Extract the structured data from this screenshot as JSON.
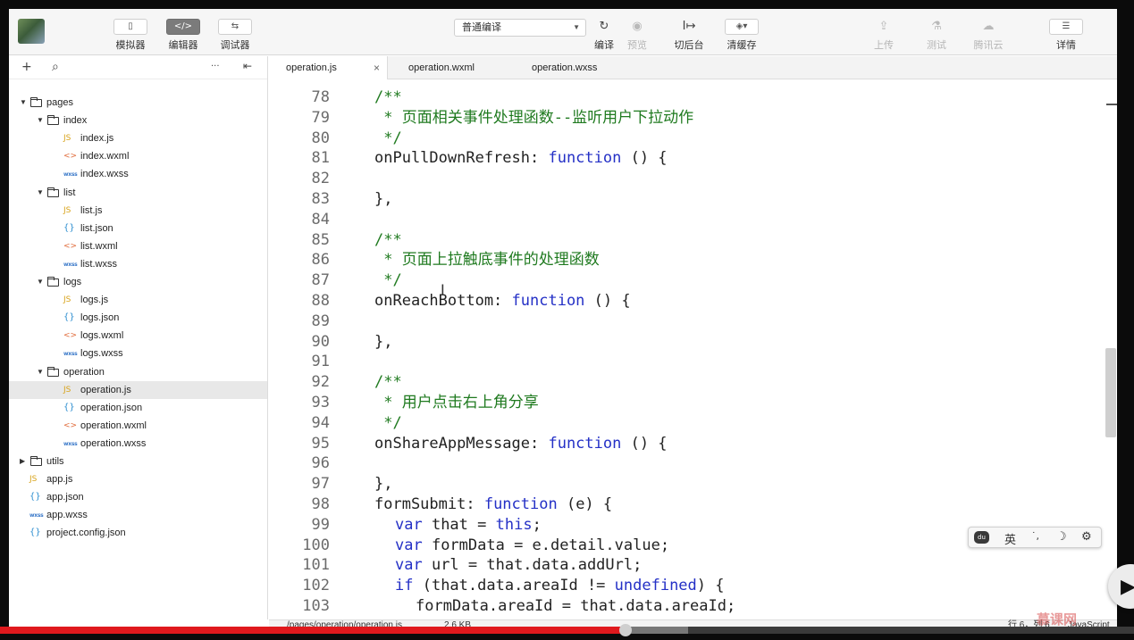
{
  "toolbar": {
    "buttons": [
      {
        "icon": "phone-icon",
        "glyph": "▯",
        "label": "模拟器"
      },
      {
        "icon": "code-icon",
        "glyph": "</>",
        "label": "编辑器"
      },
      {
        "icon": "debug-icon",
        "glyph": "⇆",
        "label": "调试器"
      }
    ],
    "compile_mode": "普通编译",
    "actions": [
      {
        "icon": "refresh-icon",
        "glyph": "↻",
        "label": "编译"
      },
      {
        "icon": "eye-icon",
        "glyph": "◉",
        "label": "预览"
      },
      {
        "icon": "switch-background-icon",
        "glyph": "I↦",
        "label": "切后台"
      },
      {
        "icon": "layers-icon",
        "glyph": "◈▾",
        "label": "清缓存"
      }
    ],
    "right_actions": [
      {
        "icon": "upload-icon",
        "glyph": "⇪",
        "label": "上传"
      },
      {
        "icon": "test-icon",
        "glyph": "⚗",
        "label": "测试"
      },
      {
        "icon": "cloud-icon",
        "glyph": "☁",
        "label": "腾讯云"
      },
      {
        "icon": "menu-icon",
        "glyph": "☰",
        "label": "详情"
      }
    ]
  },
  "sidebar": {
    "tools": [
      {
        "icon": "add-icon",
        "glyph": "+"
      },
      {
        "icon": "search-icon",
        "glyph": "⌕"
      },
      {
        "icon": "more-icon",
        "glyph": "···"
      },
      {
        "icon": "collapse-panel-icon",
        "glyph": "⇤"
      }
    ],
    "tree": [
      {
        "name": "pages",
        "type": "folder",
        "depth": 0,
        "open": true
      },
      {
        "name": "index",
        "type": "folder",
        "depth": 1,
        "open": true
      },
      {
        "name": "index.js",
        "type": "js",
        "depth": 2
      },
      {
        "name": "index.wxml",
        "type": "wxml",
        "depth": 2
      },
      {
        "name": "index.wxss",
        "type": "wxss",
        "depth": 2
      },
      {
        "name": "list",
        "type": "folder",
        "depth": 1,
        "open": true
      },
      {
        "name": "list.js",
        "type": "js",
        "depth": 2
      },
      {
        "name": "list.json",
        "type": "json",
        "depth": 2
      },
      {
        "name": "list.wxml",
        "type": "wxml",
        "depth": 2
      },
      {
        "name": "list.wxss",
        "type": "wxss",
        "depth": 2
      },
      {
        "name": "logs",
        "type": "folder",
        "depth": 1,
        "open": true
      },
      {
        "name": "logs.js",
        "type": "js",
        "depth": 2
      },
      {
        "name": "logs.json",
        "type": "json",
        "depth": 2
      },
      {
        "name": "logs.wxml",
        "type": "wxml",
        "depth": 2
      },
      {
        "name": "logs.wxss",
        "type": "wxss",
        "depth": 2
      },
      {
        "name": "operation",
        "type": "folder",
        "depth": 1,
        "open": true
      },
      {
        "name": "operation.js",
        "type": "js",
        "depth": 2,
        "selected": true
      },
      {
        "name": "operation.json",
        "type": "json",
        "depth": 2
      },
      {
        "name": "operation.wxml",
        "type": "wxml",
        "depth": 2
      },
      {
        "name": "operation.wxss",
        "type": "wxss",
        "depth": 2
      },
      {
        "name": "utils",
        "type": "folder",
        "depth": 0,
        "open": false
      },
      {
        "name": "app.js",
        "type": "js",
        "depth": 0
      },
      {
        "name": "app.json",
        "type": "json",
        "depth": 0
      },
      {
        "name": "app.wxss",
        "type": "wxss",
        "depth": 0
      },
      {
        "name": "project.config.json",
        "type": "json",
        "depth": 0
      }
    ]
  },
  "tabs": [
    {
      "label": "operation.js",
      "active": true,
      "close": "×"
    },
    {
      "label": "operation.wxml",
      "active": false
    },
    {
      "label": "operation.wxss",
      "active": false
    }
  ],
  "code": {
    "lines": [
      {
        "n": "78",
        "indent": 0,
        "parts": [
          {
            "t": "/**",
            "c": "comment"
          }
        ]
      },
      {
        "n": "79",
        "indent": 0,
        "parts": [
          {
            "t": " * 页面相关事件处理函数--监听用户下拉动作",
            "c": "comment"
          }
        ]
      },
      {
        "n": "80",
        "indent": 0,
        "parts": [
          {
            "t": " */",
            "c": "comment"
          }
        ]
      },
      {
        "n": "81",
        "indent": 0,
        "parts": [
          {
            "t": "onPullDownRefresh: ",
            "c": ""
          },
          {
            "t": "function",
            "c": "kw"
          },
          {
            "t": " () {",
            "c": ""
          }
        ]
      },
      {
        "n": "82",
        "indent": 0,
        "parts": []
      },
      {
        "n": "83",
        "indent": 0,
        "parts": [
          {
            "t": "},",
            "c": ""
          }
        ]
      },
      {
        "n": "84",
        "indent": 0,
        "parts": []
      },
      {
        "n": "85",
        "indent": 0,
        "parts": [
          {
            "t": "/**",
            "c": "comment"
          }
        ]
      },
      {
        "n": "86",
        "indent": 0,
        "parts": [
          {
            "t": " * 页面上拉触底事件的处理函数",
            "c": "comment"
          }
        ]
      },
      {
        "n": "87",
        "indent": 0,
        "parts": [
          {
            "t": " */",
            "c": "comment"
          }
        ]
      },
      {
        "n": "88",
        "indent": 0,
        "parts": [
          {
            "t": "onReachBottom: ",
            "c": ""
          },
          {
            "t": "function",
            "c": "kw"
          },
          {
            "t": " () {",
            "c": ""
          }
        ]
      },
      {
        "n": "89",
        "indent": 0,
        "parts": []
      },
      {
        "n": "90",
        "indent": 0,
        "parts": [
          {
            "t": "},",
            "c": ""
          }
        ]
      },
      {
        "n": "91",
        "indent": 0,
        "parts": []
      },
      {
        "n": "92",
        "indent": 0,
        "parts": [
          {
            "t": "/**",
            "c": "comment"
          }
        ]
      },
      {
        "n": "93",
        "indent": 0,
        "parts": [
          {
            "t": " * 用户点击右上角分享",
            "c": "comment"
          }
        ]
      },
      {
        "n": "94",
        "indent": 0,
        "parts": [
          {
            "t": " */",
            "c": "comment"
          }
        ]
      },
      {
        "n": "95",
        "indent": 0,
        "parts": [
          {
            "t": "onShareAppMessage: ",
            "c": ""
          },
          {
            "t": "function",
            "c": "kw"
          },
          {
            "t": " () {",
            "c": ""
          }
        ]
      },
      {
        "n": "96",
        "indent": 0,
        "parts": []
      },
      {
        "n": "97",
        "indent": 0,
        "parts": [
          {
            "t": "},",
            "c": ""
          }
        ]
      },
      {
        "n": "98",
        "indent": 0,
        "parts": [
          {
            "t": "formSubmit: ",
            "c": ""
          },
          {
            "t": "function",
            "c": "kw"
          },
          {
            "t": " (e) {",
            "c": ""
          }
        ]
      },
      {
        "n": "99",
        "indent": 1,
        "parts": [
          {
            "t": "var",
            "c": "kw"
          },
          {
            "t": " that = ",
            "c": ""
          },
          {
            "t": "this",
            "c": "kw"
          },
          {
            "t": ";",
            "c": ""
          }
        ]
      },
      {
        "n": "100",
        "indent": 1,
        "parts": [
          {
            "t": "var",
            "c": "kw"
          },
          {
            "t": " formData = e.detail.value;",
            "c": ""
          }
        ]
      },
      {
        "n": "101",
        "indent": 1,
        "parts": [
          {
            "t": "var",
            "c": "kw"
          },
          {
            "t": " url = that.data.addUrl;",
            "c": ""
          }
        ]
      },
      {
        "n": "102",
        "indent": 1,
        "parts": [
          {
            "t": "if",
            "c": "kw"
          },
          {
            "t": " (that.data.areaId != ",
            "c": ""
          },
          {
            "t": "undefined",
            "c": "kw"
          },
          {
            "t": ") {",
            "c": ""
          }
        ]
      },
      {
        "n": "103",
        "indent": 2,
        "parts": [
          {
            "t": "formData.areaId = that.data.areaId;",
            "c": ""
          }
        ]
      }
    ]
  },
  "ime": {
    "lang": "英",
    "punct": "˙,",
    "moon": "☽",
    "gear": "⚙",
    "logo": "du"
  },
  "status": {
    "path": "/pages/operation/operation.js",
    "size": "2.6 KB",
    "position": "行 6，列 6",
    "language": "JavaScript"
  },
  "video": {
    "progress_percent": 55.2,
    "buffered_percent": 60.7,
    "play_glyph": "▶"
  },
  "watermark": "慕课网",
  "colors": {
    "keyword": "#2430c6",
    "comment": "#1f7a1f",
    "progress": "#e0191d",
    "js": "#d8a31a",
    "wxml": "#e06c3c",
    "wxss": "#3a79c9",
    "json": "#2f8fd0"
  }
}
